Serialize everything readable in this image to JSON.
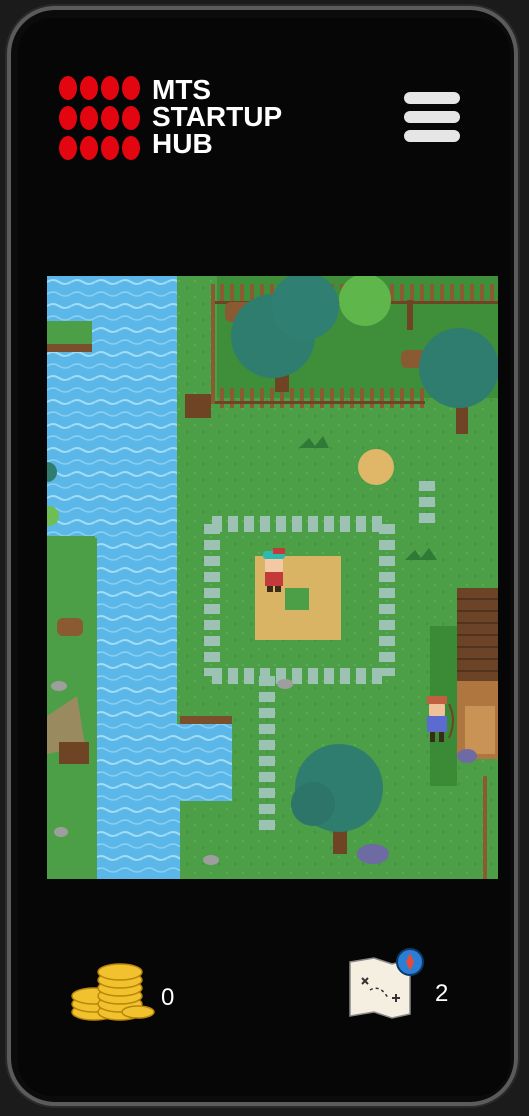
{
  "logo": {
    "line1": "MTS",
    "line2": "STARTUP",
    "line3": "HUB",
    "dot_color": "#e30611"
  },
  "menu": {
    "icon": "hamburger-menu-icon"
  },
  "game": {
    "scene": "top-down pixel forest village",
    "characters": [
      "player-character",
      "archer-npc"
    ]
  },
  "hud": {
    "coins": {
      "icon": "gold-coins-icon",
      "count": "0"
    },
    "maps": {
      "icon": "treasure-map-icon",
      "count": "2"
    }
  },
  "colors": {
    "background": "#060606",
    "frame": "#5b5b5b",
    "grass": "#4c9f46",
    "water": "#5bb7e8",
    "accent_red": "#e30611"
  }
}
